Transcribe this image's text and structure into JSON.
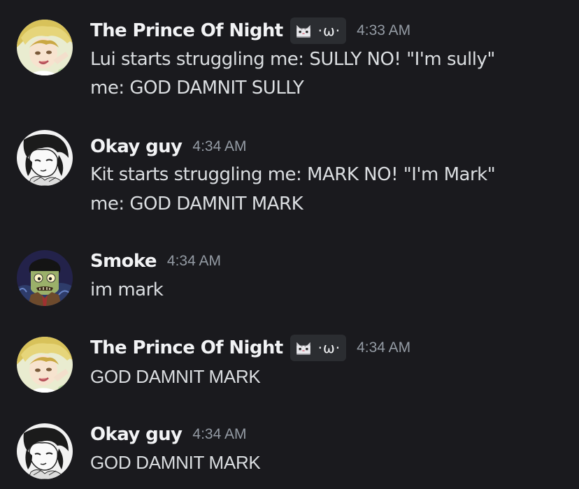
{
  "messages": [
    {
      "username": "The Prince Of Night",
      "tag": "·ω·",
      "time": "4:33 AM",
      "lines": [
        "Lui starts struggling me: SULLY NO! \"I'm sully\"",
        "me: GOD DAMNIT SULLY"
      ]
    },
    {
      "username": "Okay guy",
      "time": "4:34 AM",
      "lines": [
        "Kit starts struggling me: MARK NO! \"I'm Mark\"",
        "me: GOD DAMNIT MARK"
      ]
    },
    {
      "username": "Smoke",
      "time": "4:34 AM",
      "lines": [
        "im mark"
      ]
    },
    {
      "username": "The Prince Of Night",
      "tag": "·ω·",
      "time": "4:34 AM",
      "lines": [
        "GOD DAMNIT MARK"
      ]
    },
    {
      "username": "Okay guy",
      "time": "4:34 AM",
      "lines": [
        "GOD DAMNIT MARK"
      ]
    }
  ],
  "icons": {
    "prince_avatar": "anime-blonde-avatar",
    "okay_avatar": "anime-sketch-avatar",
    "smoke_avatar": "zombie-avatar",
    "tag_icon": "pixel-cat-icon"
  },
  "colors": {
    "background": "#1a1a1e",
    "username": "#f2f3f5",
    "text": "#dbdee1",
    "timestamp": "#949ba4",
    "tag_bg": "#2b2d31"
  }
}
